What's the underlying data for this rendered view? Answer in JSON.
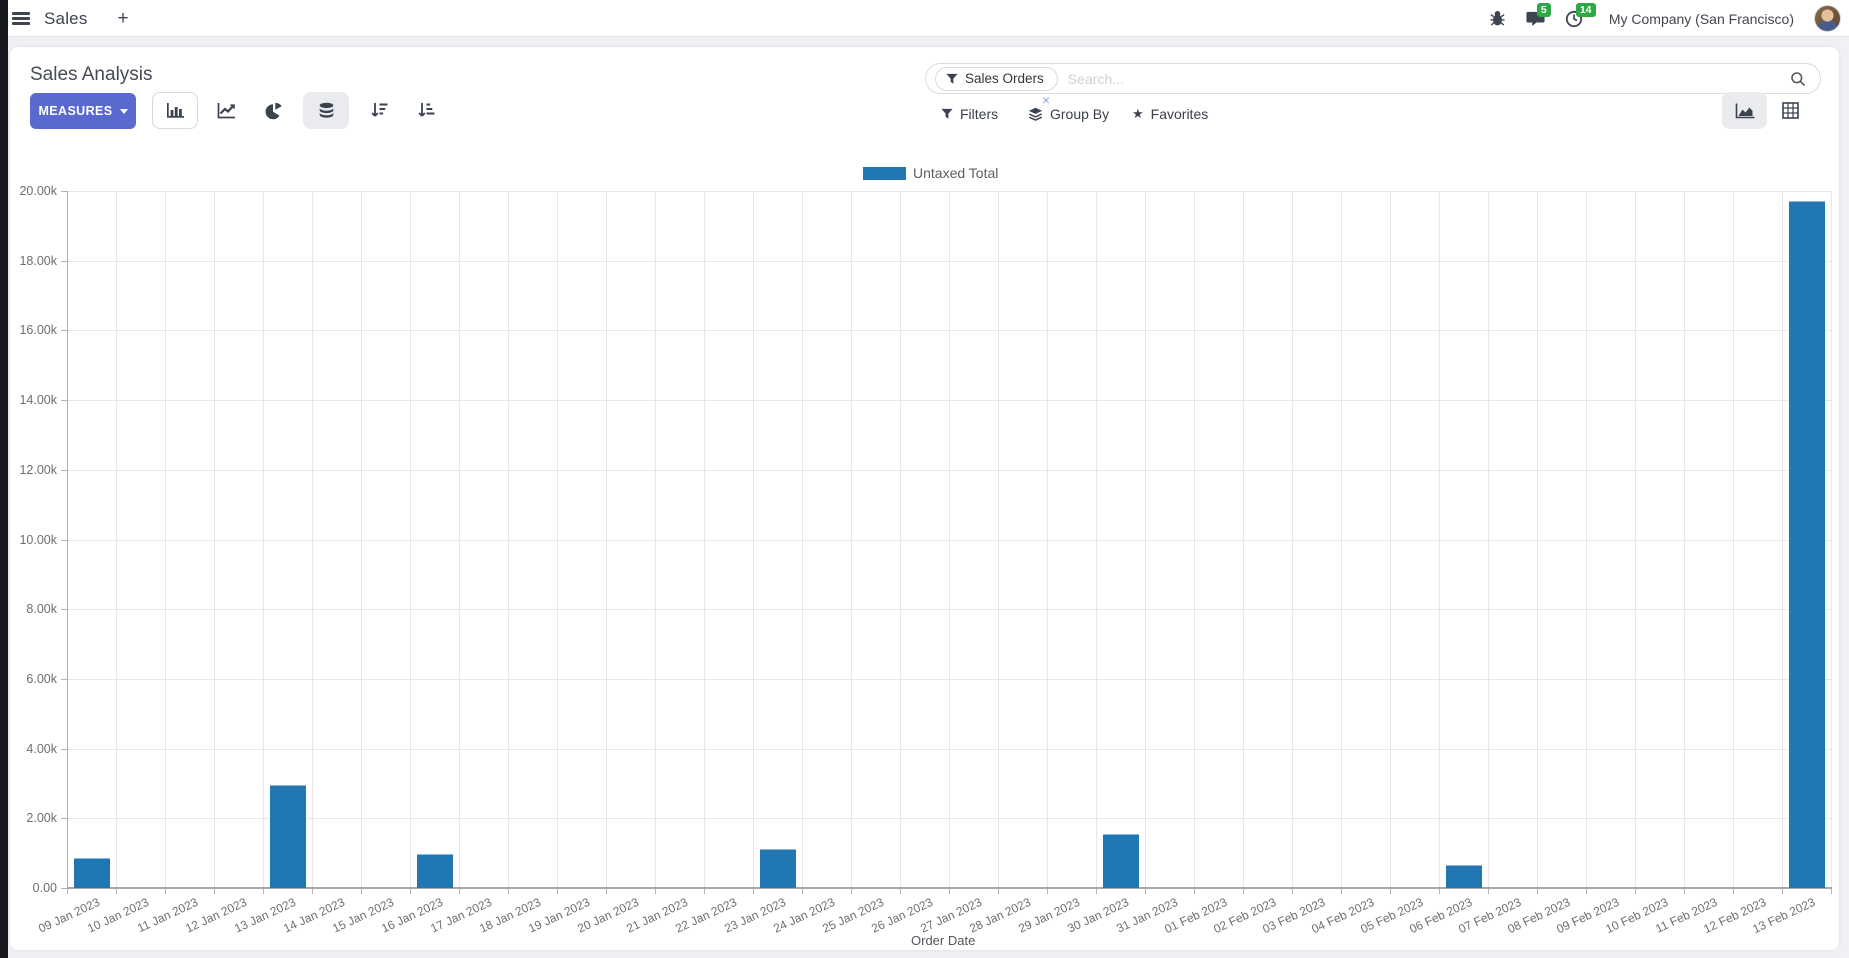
{
  "navbar": {
    "app_label": "Sales",
    "message_count": "5",
    "activity_count": "14",
    "company": "My Company (San Francisco)"
  },
  "icons": {
    "plus": "+",
    "star": "★",
    "close": "×"
  },
  "control_panel": {
    "title": "Sales Analysis",
    "measures_label": "MEASURES",
    "filters_label": "Filters",
    "group_by_label": "Group By",
    "favorites_label": "Favorites"
  },
  "search": {
    "facet_label": "Sales Orders",
    "placeholder": "Search..."
  },
  "chart_data": {
    "type": "bar",
    "title": "",
    "xlabel": "Order Date",
    "ylabel": "",
    "ylim": [
      0,
      20000
    ],
    "grid": true,
    "legend_position": "top",
    "ytick_labels": [
      "0.00",
      "2.00k",
      "4.00k",
      "6.00k",
      "8.00k",
      "10.00k",
      "12.00k",
      "14.00k",
      "16.00k",
      "18.00k",
      "20.00k"
    ],
    "categories": [
      "09 Jan 2023",
      "10 Jan 2023",
      "11 Jan 2023",
      "12 Jan 2023",
      "13 Jan 2023",
      "14 Jan 2023",
      "15 Jan 2023",
      "16 Jan 2023",
      "17 Jan 2023",
      "18 Jan 2023",
      "19 Jan 2023",
      "20 Jan 2023",
      "21 Jan 2023",
      "22 Jan 2023",
      "23 Jan 2023",
      "24 Jan 2023",
      "25 Jan 2023",
      "26 Jan 2023",
      "27 Jan 2023",
      "28 Jan 2023",
      "29 Jan 2023",
      "30 Jan 2023",
      "31 Jan 2023",
      "01 Feb 2023",
      "02 Feb 2023",
      "03 Feb 2023",
      "04 Feb 2023",
      "05 Feb 2023",
      "06 Feb 2023",
      "07 Feb 2023",
      "08 Feb 2023",
      "09 Feb 2023",
      "10 Feb 2023",
      "11 Feb 2023",
      "12 Feb 2023",
      "13 Feb 2023"
    ],
    "series": [
      {
        "name": "Untaxed Total",
        "color": "#2077b4",
        "values": [
          850,
          0,
          0,
          0,
          2950,
          0,
          0,
          980,
          0,
          0,
          0,
          0,
          0,
          0,
          1120,
          0,
          0,
          0,
          0,
          0,
          0,
          1550,
          0,
          0,
          0,
          0,
          0,
          0,
          660,
          0,
          0,
          0,
          0,
          0,
          0,
          19700
        ]
      }
    ]
  }
}
